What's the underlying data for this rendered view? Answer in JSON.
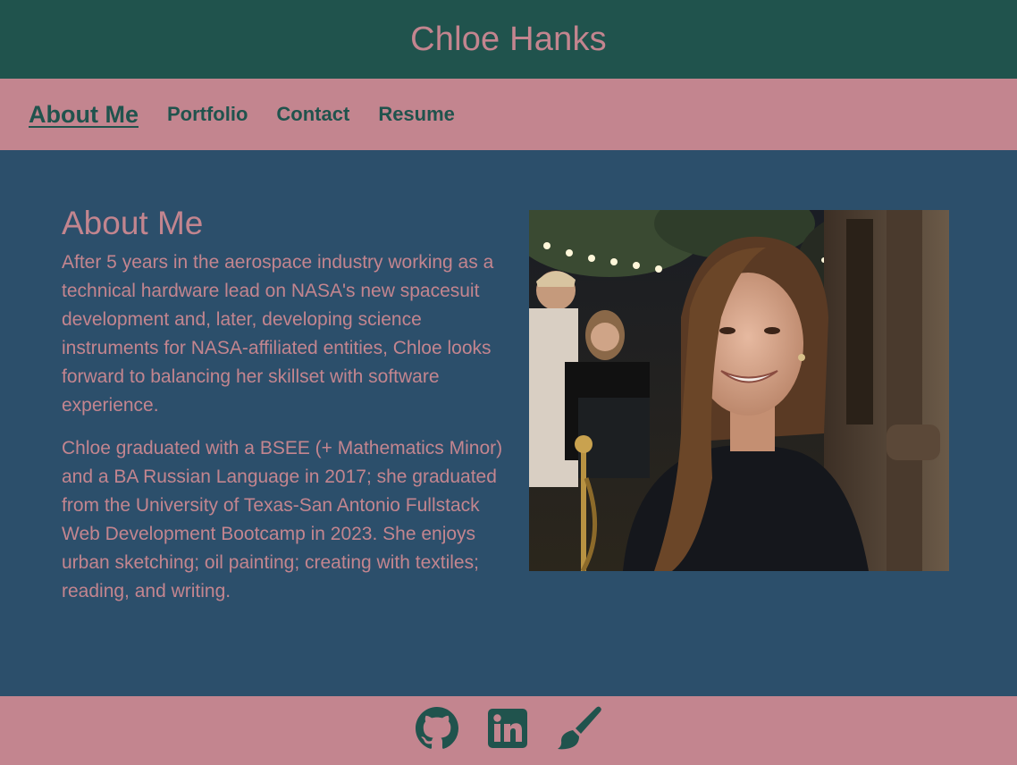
{
  "header": {
    "title": "Chloe Hanks"
  },
  "nav": {
    "items": [
      {
        "label": "About Me",
        "active": true
      },
      {
        "label": "Portfolio",
        "active": false
      },
      {
        "label": "Contact",
        "active": false
      },
      {
        "label": "Resume",
        "active": false
      }
    ]
  },
  "about": {
    "heading": "About Me",
    "paragraph_1": "After 5 years in the aerospace industry working as a technical hardware lead on NASA's new spacesuit development and, later, developing science instruments for NASA-affiliated entities, Chloe looks forward to balancing her skillset with software experience.",
    "paragraph_2": "Chloe graduated with a BSEE (+ Mathematics Minor) and a BA Russian Language in 2017; she graduated from the University of Texas-San Antonio Fullstack Web Development Bootcamp in 2023. She enjoys urban sketching; oil painting; creating with textiles; reading, and writing."
  },
  "footer": {
    "icons": [
      "github-icon",
      "linkedin-icon",
      "paintbrush-icon"
    ]
  },
  "colors": {
    "header_bg": "#20534d",
    "accent_pink": "#c3858f",
    "main_bg": "#2c4f6b"
  }
}
